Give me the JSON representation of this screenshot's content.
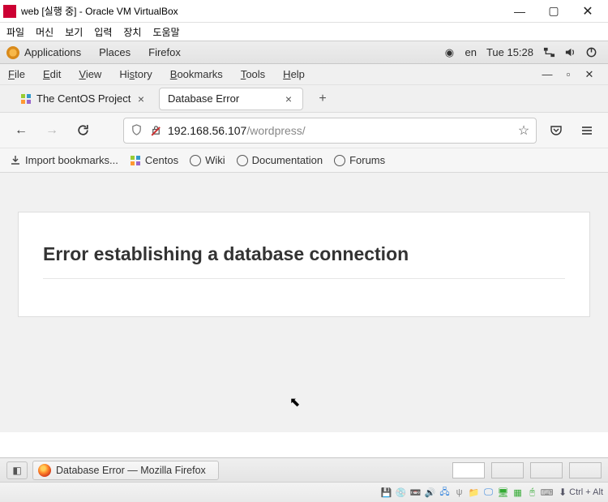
{
  "vb": {
    "title": "web [실행 중] - Oracle VM VirtualBox",
    "menu": [
      "파일",
      "머신",
      "보기",
      "입력",
      "장치",
      "도움말"
    ],
    "hostkey": "Ctrl + Alt"
  },
  "gnome": {
    "applications": "Applications",
    "places": "Places",
    "firefox": "Firefox",
    "lang": "en",
    "clock": "Tue 15:28"
  },
  "ffmenu": {
    "file": "File",
    "edit": "Edit",
    "view": "View",
    "history": "History",
    "bookmarks": "Bookmarks",
    "tools": "Tools",
    "help": "Help"
  },
  "tabs": [
    {
      "label": "The CentOS Project"
    },
    {
      "label": "Database Error"
    }
  ],
  "url": {
    "host": "192.168.56.107",
    "path": "/wordpress/"
  },
  "bmt": {
    "import": "Import bookmarks...",
    "items": [
      "Centos",
      "Wiki",
      "Documentation",
      "Forums"
    ]
  },
  "page": {
    "heading": "Error establishing a database connection"
  },
  "taskbar": {
    "task": "Database Error — Mozilla Firefox"
  }
}
